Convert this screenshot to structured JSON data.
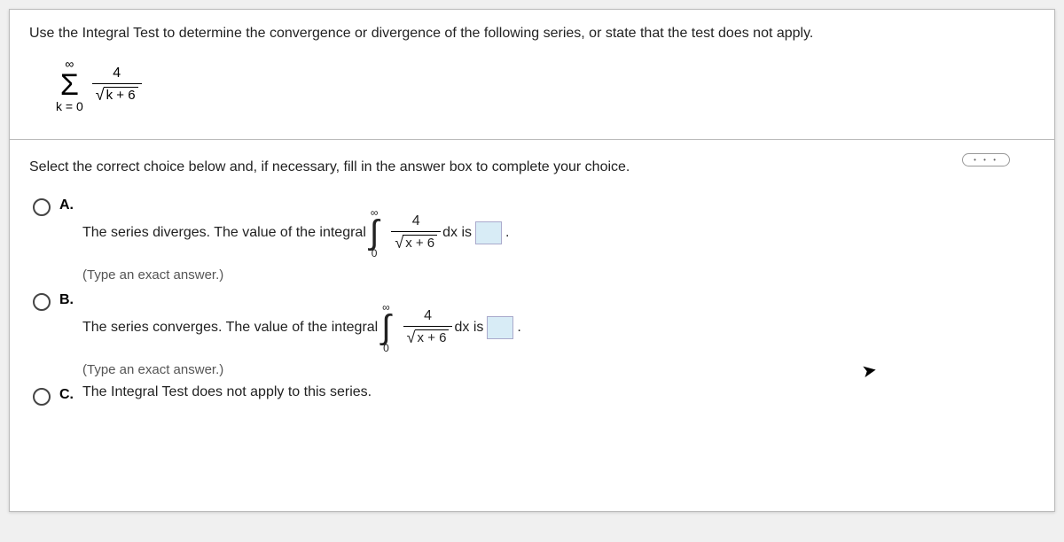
{
  "question": "Use the Integral Test to determine the convergence or divergence of the following series, or state that the test does not apply.",
  "series": {
    "top": "∞",
    "bottom": "k = 0",
    "numerator": "4",
    "radicand": "k + 6"
  },
  "instruction": "Select the correct choice below and, if necessary, fill in the answer box to complete your choice.",
  "choices": {
    "A": {
      "label": "A.",
      "text_before": "The series diverges. The value of the integral",
      "int_top": "∞",
      "int_bot": "0",
      "frac_num": "4",
      "frac_rad": "x + 6",
      "after": "dx is",
      "period": ".",
      "hint": "(Type an exact answer.)"
    },
    "B": {
      "label": "B.",
      "text_before": "The series converges. The value of the integral",
      "int_top": "∞",
      "int_bot": "0",
      "frac_num": "4",
      "frac_rad": "x + 6",
      "after": "dx is",
      "period": ".",
      "hint": "(Type an exact answer.)"
    },
    "C": {
      "label": "C.",
      "text": "The Integral Test does not apply to this series."
    }
  },
  "more": "• • •"
}
